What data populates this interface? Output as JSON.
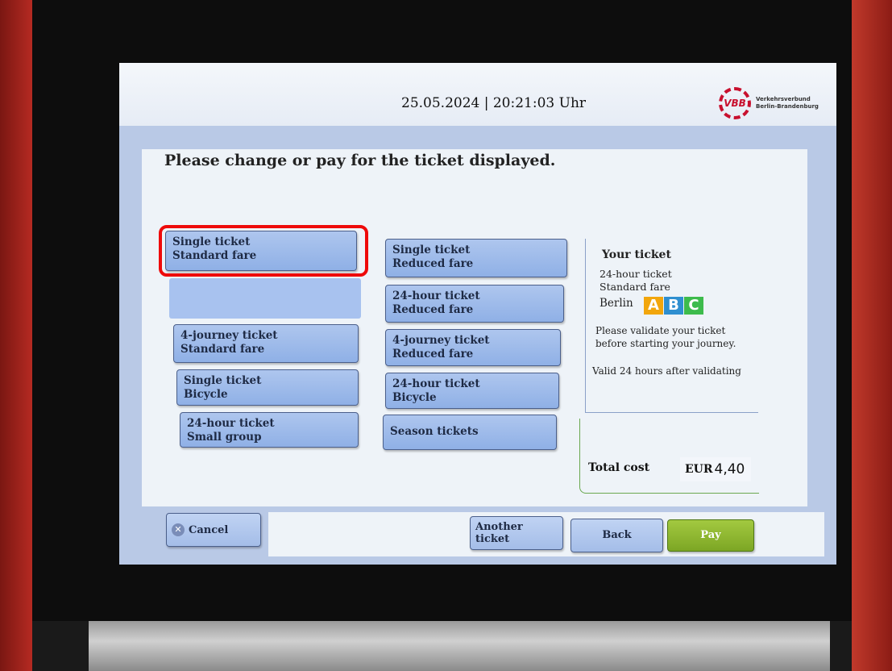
{
  "header": {
    "datetime": "25.05.2024 | 20:21:03 Uhr",
    "logo_mark": "VBB",
    "logo_text_line1": "Verkehrsverbund",
    "logo_text_line2": "Berlin-Brandenburg"
  },
  "main": {
    "heading": "Please change or pay for the ticket displayed."
  },
  "tickets_left": [
    {
      "line1": "Single ticket",
      "line2": "Standard fare"
    },
    {
      "line1": "4-journey ticket",
      "line2": "Standard fare"
    },
    {
      "line1": "Single ticket",
      "line2": "Bicycle"
    },
    {
      "line1": "24-hour ticket",
      "line2": "Small group"
    }
  ],
  "tickets_middle": [
    {
      "line1": "Single ticket",
      "line2": "Reduced fare"
    },
    {
      "line1": "24-hour ticket",
      "line2": "Reduced fare"
    },
    {
      "line1": "4-journey ticket",
      "line2": "Reduced fare"
    },
    {
      "line1": "24-hour ticket",
      "line2": "Bicycle"
    },
    {
      "line1": "Season tickets",
      "line2": ""
    }
  ],
  "your_ticket": {
    "title": "Your ticket",
    "type": "24-hour ticket",
    "fare": "Standard fare",
    "area": "Berlin",
    "zones": [
      "A",
      "B",
      "C"
    ],
    "zone_colors": [
      "#f2a60c",
      "#2f8fd0",
      "#3dbb4c"
    ],
    "note_line1": "Please validate your ticket",
    "note_line2": "before starting your journey.",
    "validity": "Valid 24 hours after validating"
  },
  "total": {
    "label": "Total cost",
    "currency": "EUR",
    "amount": "4,40"
  },
  "footer": {
    "cancel_label": "Cancel",
    "cancel_icon": "close-circle-icon",
    "another_line1": "Another",
    "another_line2": "ticket",
    "back_label": "Back",
    "pay_label": "Pay"
  },
  "colors": {
    "highlight": "#ee0a0a",
    "pay_button": "#8cb82f",
    "brand_red": "#c8102e"
  }
}
